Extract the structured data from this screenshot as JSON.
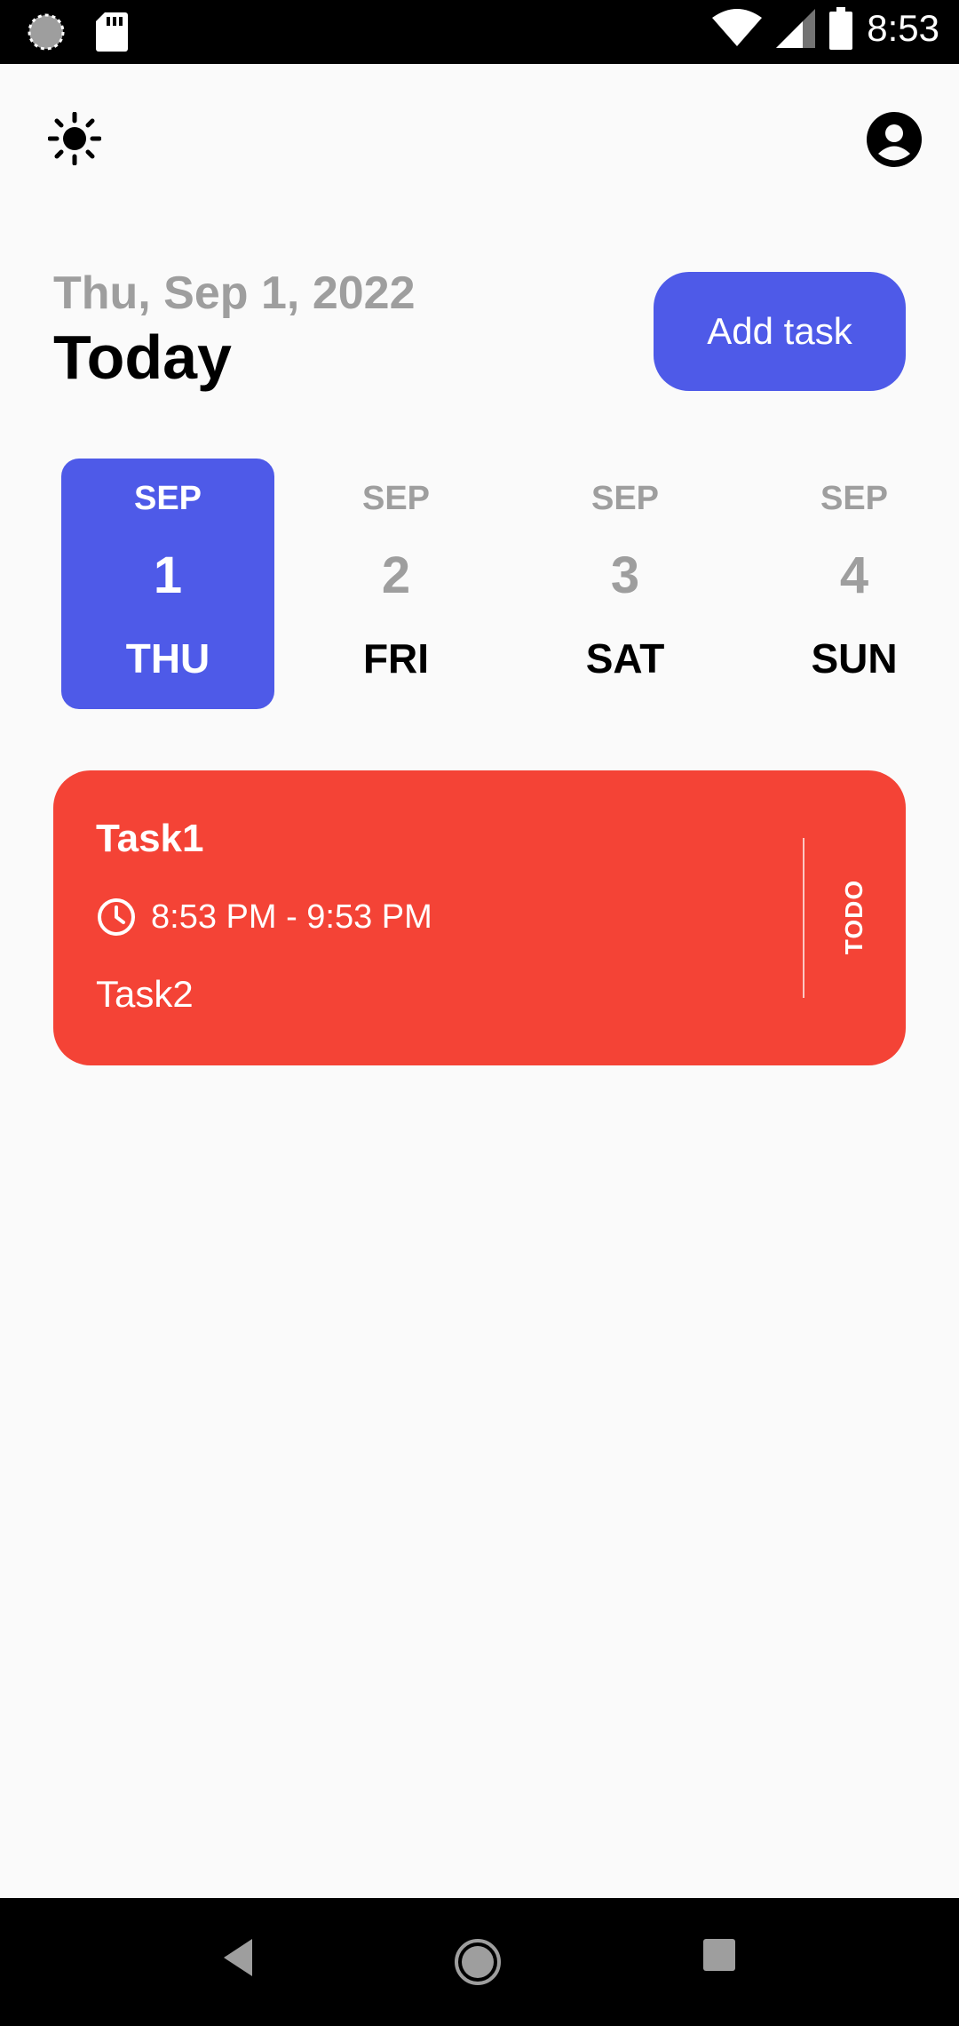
{
  "status_bar": {
    "time": "8:53",
    "icons": [
      "loading-icon",
      "sd-card-icon",
      "wifi-icon",
      "signal-icon",
      "battery-icon"
    ]
  },
  "header": {
    "theme_icon": "sun-icon",
    "profile_icon": "account-circle-icon"
  },
  "date_header": {
    "date_text": "Thu, Sep 1, 2022",
    "title": "Today",
    "add_button_label": "Add task"
  },
  "date_picker": {
    "days": [
      {
        "month": "SEP",
        "day": "1",
        "weekday": "THU",
        "selected": true
      },
      {
        "month": "SEP",
        "day": "2",
        "weekday": "FRI",
        "selected": false
      },
      {
        "month": "SEP",
        "day": "3",
        "weekday": "SAT",
        "selected": false
      },
      {
        "month": "SEP",
        "day": "4",
        "weekday": "SUN",
        "selected": false
      }
    ]
  },
  "tasks": [
    {
      "title": "Task1",
      "time": "8:53 PM - 9:53 PM",
      "note": "Task2",
      "status": "TODO",
      "color": "#f44336"
    }
  ],
  "colors": {
    "accent": "#4e5ae8",
    "task_red": "#f44336",
    "muted_text": "#9e9e9e"
  },
  "nav_bar": {
    "icons": [
      "back-icon",
      "home-icon",
      "recents-icon"
    ]
  }
}
